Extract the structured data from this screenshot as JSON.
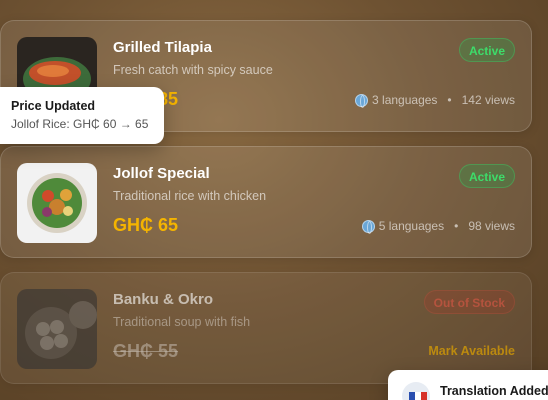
{
  "items": [
    {
      "name": "Grilled Tilapia",
      "description": "Fresh catch with spicy sauce",
      "price": "GH₵ 85",
      "status": "Active",
      "languages": "3 languages",
      "views": "142 views"
    },
    {
      "name": "Jollof Special",
      "description": "Traditional rice with chicken",
      "price": "GH₵ 65",
      "status": "Active",
      "languages": "5 languages",
      "views": "98 views"
    },
    {
      "name": "Banku & Okro",
      "description": "Traditional soup with fish",
      "price": "GH₵ 55",
      "status": "Out of Stock",
      "action": "Mark Available"
    }
  ],
  "toasts": {
    "price_updated": {
      "title": "Price Updated",
      "body": "Jollof Rice: GH₵ 60 → 65"
    },
    "translation": {
      "title": "Translation Added"
    }
  },
  "colors": {
    "price": "#f5b400",
    "active": "#3ddc6a",
    "out_of_stock": "#e85a4a"
  }
}
